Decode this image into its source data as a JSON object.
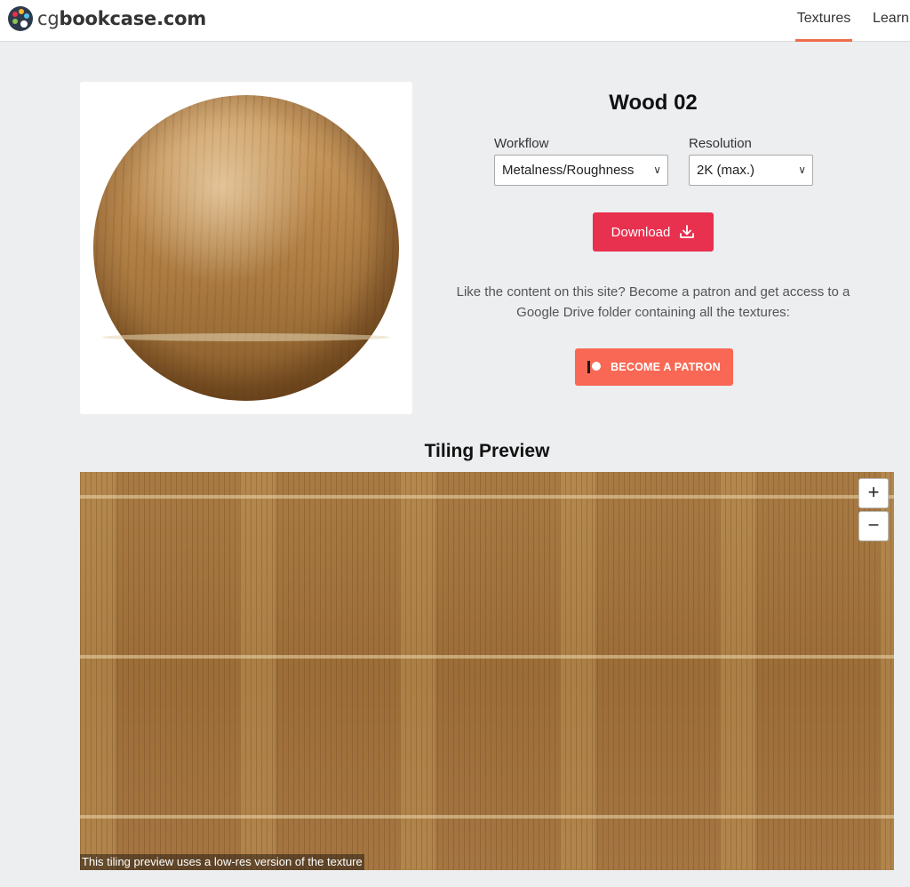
{
  "header": {
    "logo_prefix": "cg",
    "logo_main": "bookcase",
    "logo_suffix": ".com",
    "nav": [
      {
        "label": "Textures",
        "active": true
      },
      {
        "label": "Learn",
        "active": false
      }
    ]
  },
  "texture": {
    "title": "Wood 02"
  },
  "workflow": {
    "label": "Workflow",
    "selected": "Metalness/Roughness"
  },
  "resolution": {
    "label": "Resolution",
    "selected": "2K (max.)"
  },
  "download": {
    "label": "Download"
  },
  "promo": {
    "text": "Like the content on this site? Become a patron and get access to a Google Drive folder containing all the textures:"
  },
  "patron": {
    "label": "BECOME A PATRON"
  },
  "tiling": {
    "title": "Tiling Preview",
    "zoom_in": "+",
    "zoom_out": "−",
    "caption": "This tiling preview uses a low-res version of the texture"
  },
  "colors": {
    "accent_nav": "#ef6b4a",
    "download_button": "#e8304f",
    "patron_button": "#f96854",
    "page_background": "#eceef0"
  }
}
